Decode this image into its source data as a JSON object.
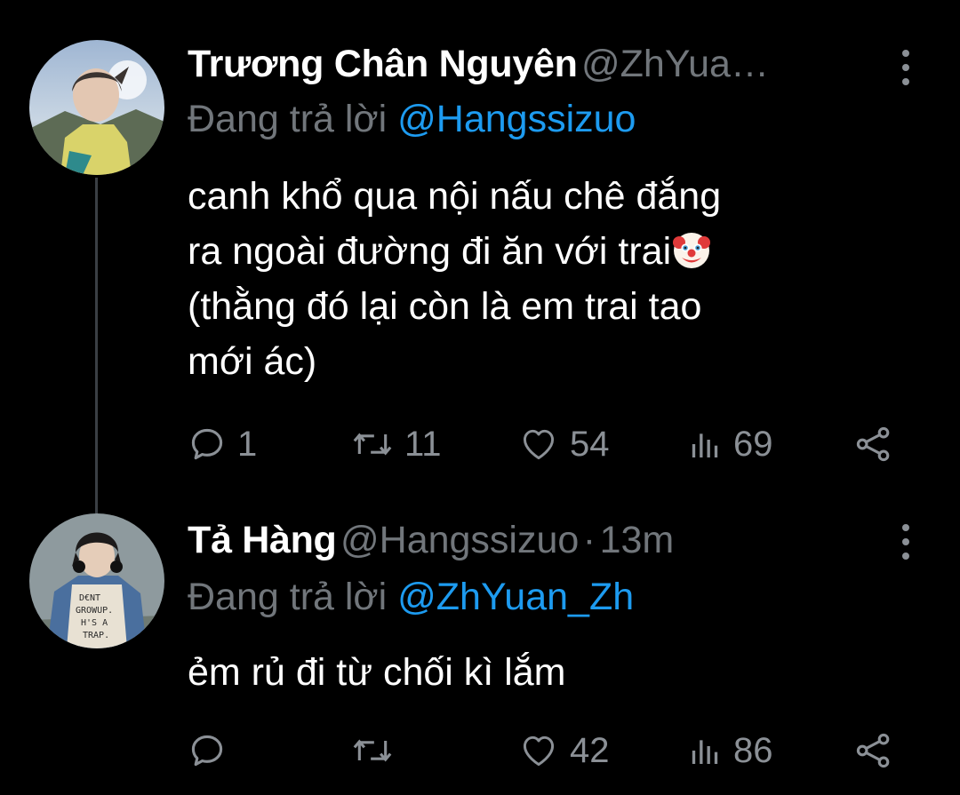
{
  "theme": {
    "background": "#000000",
    "text_primary": "#ffffff",
    "text_secondary": "#71767b",
    "accent": "#1d9bf0",
    "icon_color": "#8b9096"
  },
  "tweets": [
    {
      "display_name": "Trương Chân Nguyên",
      "handle": "@ZhYua…",
      "reply_prefix": "Đang trả lời",
      "reply_to": "@Hangssizuo",
      "body": "canh khổ qua nội nấu chê đắng\nra ngoài đường đi ăn với trai",
      "body_emoji": "clown-face",
      "body_cont": "(thằng đó lại còn là em trai tao\nmới ác)",
      "replies": "1",
      "retweets": "11",
      "likes": "54",
      "views": "69"
    },
    {
      "display_name": "Tả Hàng",
      "handle": "@Hangssizuo",
      "separator": "·",
      "time": "13m",
      "reply_prefix": "Đang trả lời",
      "reply_to": "@ZhYuan_Zh",
      "body": "ẻm rủ đi từ chối kì lắm",
      "replies": "",
      "retweets": "",
      "likes": "42",
      "views": "86"
    }
  ],
  "icons": {
    "more": "more-vertical-icon",
    "reply": "reply-icon",
    "retweet": "retweet-icon",
    "like": "heart-icon",
    "views": "views-icon",
    "share": "share-icon"
  }
}
